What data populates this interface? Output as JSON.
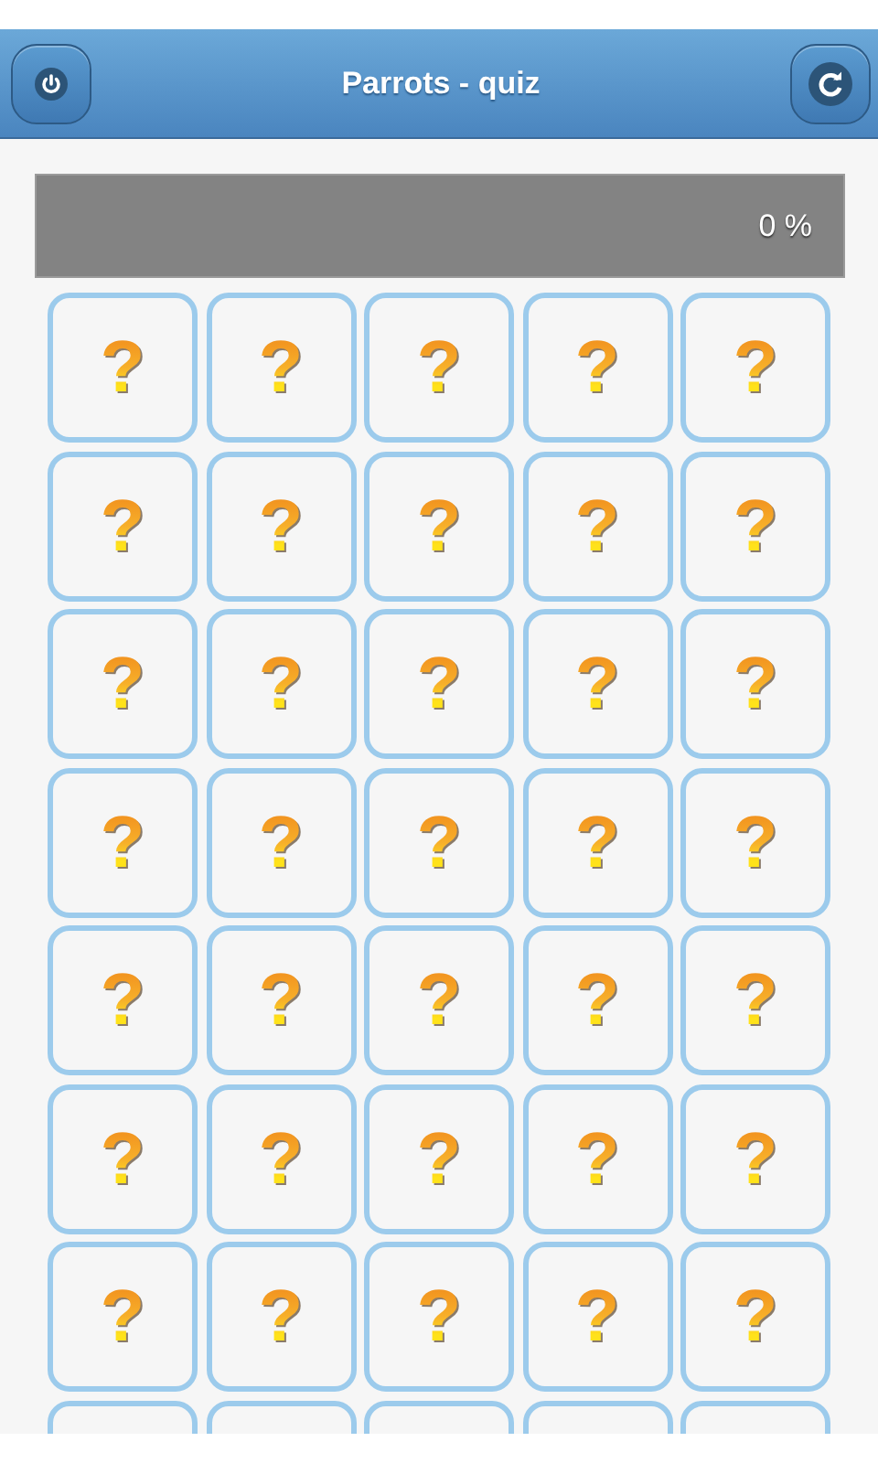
{
  "header": {
    "title": "Parrots - quiz"
  },
  "progress": {
    "level": 0,
    "reading": "0 %"
  },
  "cards": [
    {
      "kind": "hidden",
      "label": "?"
    },
    {
      "kind": "hidden",
      "label": "?"
    },
    {
      "kind": "hidden",
      "label": "?"
    },
    {
      "kind": "hidden",
      "label": "?"
    },
    {
      "kind": "hidden",
      "label": "?"
    },
    {
      "kind": "hidden",
      "label": "?"
    },
    {
      "kind": "hidden",
      "label": "?"
    },
    {
      "kind": "hidden",
      "label": "?"
    },
    {
      "kind": "hidden",
      "label": "?"
    },
    {
      "kind": "hidden",
      "label": "?"
    },
    {
      "kind": "hidden",
      "label": "?"
    },
    {
      "kind": "hidden",
      "label": "?"
    },
    {
      "kind": "hidden",
      "label": "?"
    },
    {
      "kind": "hidden",
      "label": "?"
    },
    {
      "kind": "hidden",
      "label": "?"
    },
    {
      "kind": "hidden",
      "label": "?"
    },
    {
      "kind": "hidden",
      "label": "?"
    },
    {
      "kind": "hidden",
      "label": "?"
    },
    {
      "kind": "hidden",
      "label": "?"
    },
    {
      "kind": "hidden",
      "label": "?"
    },
    {
      "kind": "hidden",
      "label": "?"
    },
    {
      "kind": "hidden",
      "label": "?"
    },
    {
      "kind": "hidden",
      "label": "?"
    },
    {
      "kind": "hidden",
      "label": "?"
    },
    {
      "kind": "hidden",
      "label": "?"
    },
    {
      "kind": "hidden",
      "label": "?"
    },
    {
      "kind": "hidden",
      "label": "?"
    },
    {
      "kind": "hidden",
      "label": "?"
    },
    {
      "kind": "hidden",
      "label": "?"
    },
    {
      "kind": "hidden",
      "label": "?"
    },
    {
      "kind": "hidden",
      "label": "?"
    },
    {
      "kind": "hidden",
      "label": "?"
    },
    {
      "kind": "hidden",
      "label": "?"
    },
    {
      "kind": "hidden",
      "label": "?"
    },
    {
      "kind": "hidden",
      "label": "?"
    },
    {
      "kind": "hidden"
    },
    {
      "kind": "hidden"
    },
    {
      "kind": "hidden"
    },
    {
      "kind": "hidden"
    },
    {
      "kind": "hidden"
    }
  ]
}
